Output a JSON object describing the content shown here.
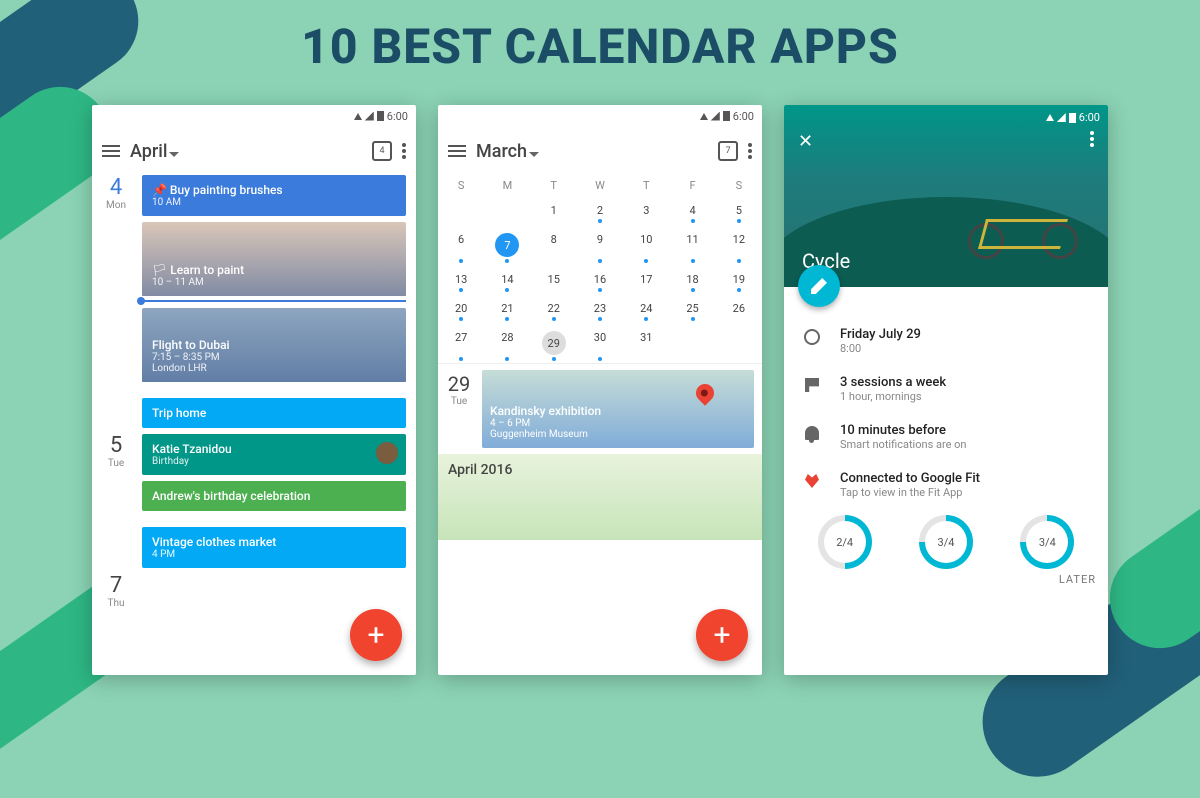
{
  "title": "10 BEST CALENDAR APPS",
  "statusbar": {
    "time": "6:00"
  },
  "screen1": {
    "month": "April",
    "today_num": "4",
    "days": [
      {
        "num": "4",
        "dow": "Mon"
      },
      {
        "num": "5",
        "dow": "Tue"
      },
      {
        "num": "7",
        "dow": "Thu"
      }
    ],
    "events": {
      "d4": [
        {
          "title": "📌 Buy painting brushes",
          "time": "10 AM",
          "color": "#3A7BDB"
        },
        {
          "title": "🏳 Learn to paint",
          "time": "10 – 11 AM",
          "image": true
        },
        {
          "title": "Flight to Dubai",
          "time": "7:15 – 8:35 PM",
          "sub": "London LHR",
          "image": true
        }
      ],
      "d5": [
        {
          "title": "Trip home",
          "time": "",
          "color": "#03A9F4"
        },
        {
          "title": "Katie Tzanidou",
          "time": "Birthday",
          "color": "#009688",
          "avatar": true
        },
        {
          "title": "Andrew's birthday celebration",
          "time": "",
          "color": "#4CAF50"
        }
      ],
      "d7": [
        {
          "title": "Vintage clothes market",
          "time": "4 PM",
          "color": "#03A9F4"
        }
      ]
    }
  },
  "screen2": {
    "month": "March",
    "today_num": "7",
    "dow": [
      "S",
      "M",
      "T",
      "W",
      "T",
      "F",
      "S"
    ],
    "weeks": [
      [
        "",
        "",
        "1",
        "2",
        "3",
        "4",
        "5"
      ],
      [
        "6",
        "7",
        "8",
        "9",
        "10",
        "11",
        "12"
      ],
      [
        "13",
        "14",
        "15",
        "16",
        "17",
        "18",
        "19"
      ],
      [
        "20",
        "21",
        "22",
        "23",
        "24",
        "25",
        "26"
      ],
      [
        "27",
        "28",
        "29",
        "30",
        "31",
        "",
        ""
      ]
    ],
    "today": "7",
    "selected": "29",
    "selected_day": {
      "num": "29",
      "dow": "Tue"
    },
    "event": {
      "title": "Kandinsky exhibition",
      "time": "4 – 6 PM",
      "place": "Guggenheim Museum"
    },
    "next_month": "April 2016"
  },
  "screen3": {
    "title": "Cycle",
    "rows": [
      {
        "l1": "Friday July 29",
        "l2": "8:00"
      },
      {
        "l1": "3 sessions a week",
        "l2": "1 hour, mornings"
      },
      {
        "l1": "10 minutes before",
        "l2": "Smart notifications are on"
      },
      {
        "l1": "Connected to Google Fit",
        "l2": "Tap to view in the Fit App"
      }
    ],
    "arcs": [
      "2/4",
      "3/4",
      "3/4"
    ],
    "later": "LATER"
  }
}
